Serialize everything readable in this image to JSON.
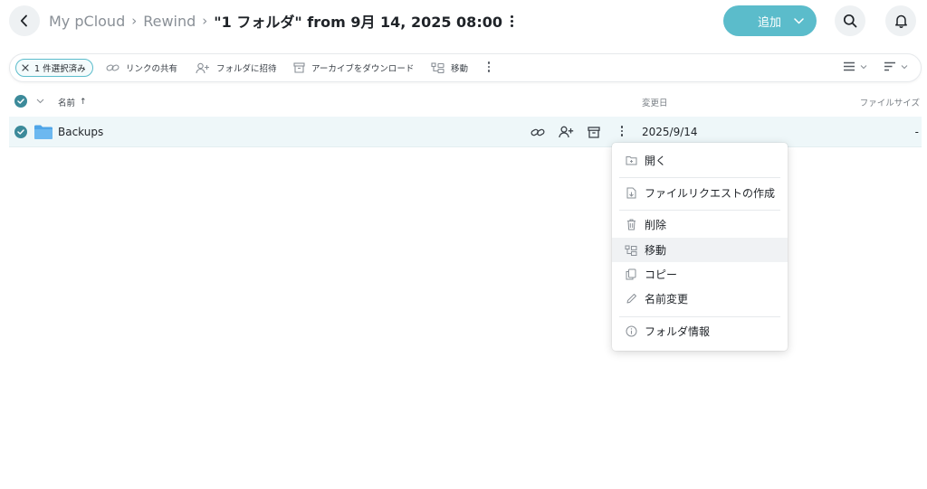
{
  "header": {
    "breadcrumbs": [
      "My pCloud",
      "Rewind"
    ],
    "current": "\"1 フォルダ\" from 9月 14, 2025 08:00",
    "add_label": "追加"
  },
  "toolbar": {
    "selected": "1 件選択済み",
    "share_link": "リンクの共有",
    "invite": "フォルダに招待",
    "download_archive": "アーカイブをダウンロード",
    "move": "移動"
  },
  "columns": {
    "name": "名前",
    "modified": "変更日",
    "size": "ファイルサイズ"
  },
  "rows": [
    {
      "name": "Backups",
      "modified": "2025/9/14",
      "size": "-",
      "selected": true
    }
  ],
  "context_menu": {
    "items": [
      {
        "label": "開く",
        "icon": "folder-open-icon"
      },
      {
        "label": "ファイルリクエストの作成",
        "icon": "file-request-icon"
      },
      {
        "label": "削除",
        "icon": "trash-icon"
      },
      {
        "label": "移動",
        "icon": "move-icon",
        "highlighted": true
      },
      {
        "label": "コピー",
        "icon": "copy-icon"
      },
      {
        "label": "名前変更",
        "icon": "pencil-icon"
      },
      {
        "label": "フォルダ情報",
        "icon": "info-icon"
      }
    ]
  },
  "colors": {
    "accent": "#5bbccb",
    "check": "#3c8a9a",
    "row_selected": "#eef7f9",
    "menu_hover": "#f0f2f4"
  }
}
